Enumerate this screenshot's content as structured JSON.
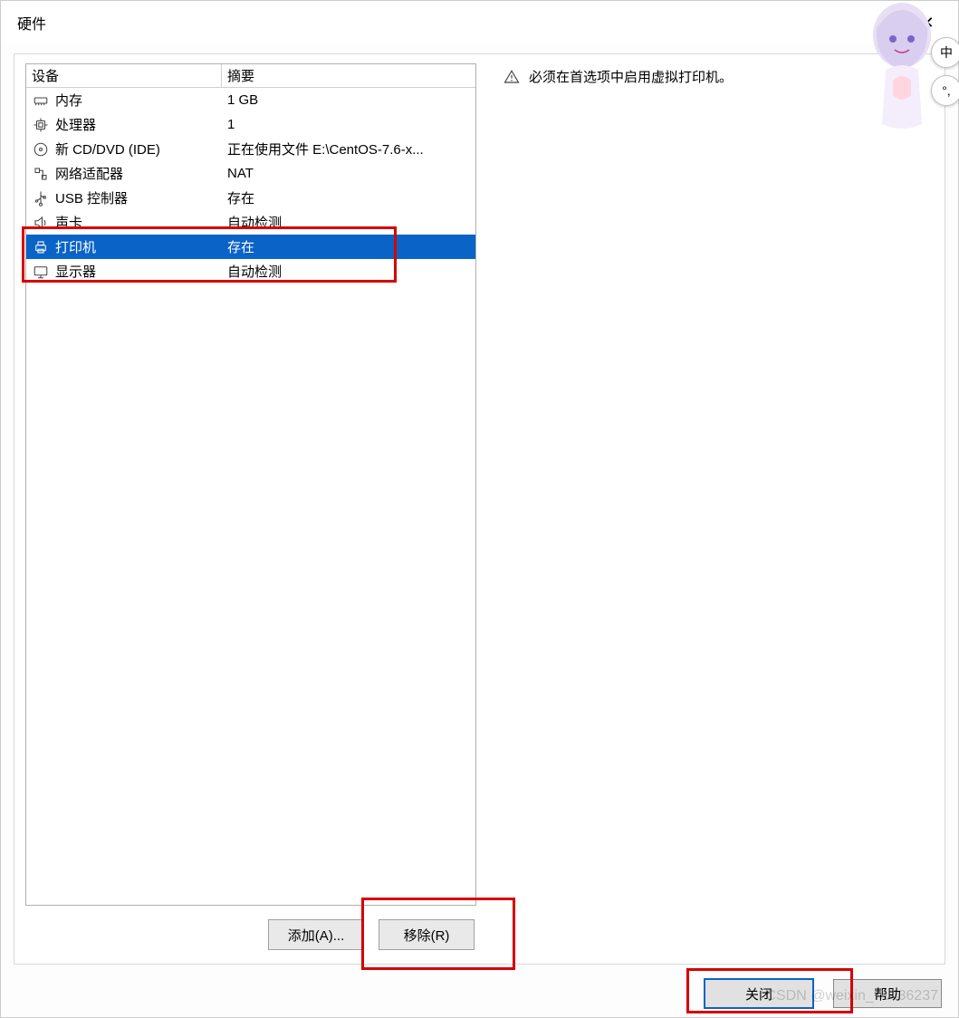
{
  "window": {
    "title": "硬件",
    "close_label": "✕"
  },
  "table": {
    "header_device": "设备",
    "header_summary": "摘要",
    "rows": [
      {
        "icon": "memory-icon",
        "name": "内存",
        "summary": "1 GB",
        "selected": false
      },
      {
        "icon": "cpu-icon",
        "name": "处理器",
        "summary": "1",
        "selected": false
      },
      {
        "icon": "disc-icon",
        "name": "新 CD/DVD (IDE)",
        "summary": "正在使用文件 E:\\CentOS-7.6-x...",
        "selected": false
      },
      {
        "icon": "network-icon",
        "name": "网络适配器",
        "summary": "NAT",
        "selected": false
      },
      {
        "icon": "usb-icon",
        "name": "USB 控制器",
        "summary": "存在",
        "selected": false
      },
      {
        "icon": "speaker-icon",
        "name": "声卡",
        "summary": "自动检测",
        "selected": false
      },
      {
        "icon": "printer-icon",
        "name": "打印机",
        "summary": "存在",
        "selected": true
      },
      {
        "icon": "display-icon",
        "name": "显示器",
        "summary": "自动检测",
        "selected": false
      }
    ]
  },
  "right_panel": {
    "warning_text": "必须在首选项中启用虚拟打印机。"
  },
  "buttons": {
    "add": "添加(A)...",
    "remove": "移除(R)",
    "close": "关闭",
    "help": "帮助"
  },
  "ime": {
    "lang": "中",
    "punct": "°,"
  },
  "watermark": "CSDN @weixin_71436237"
}
